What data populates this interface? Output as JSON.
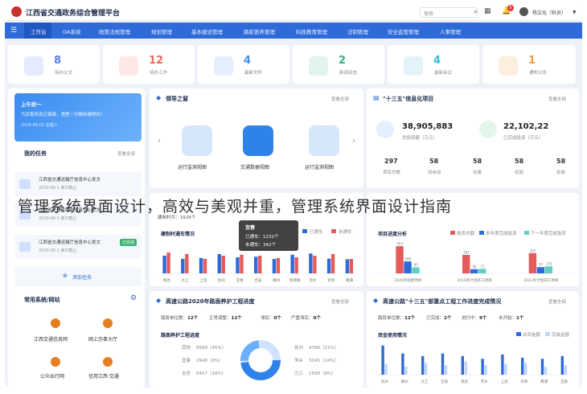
{
  "header": {
    "title": "江西省交通政务综合管理平台",
    "search_placeholder": "搜索",
    "notification_count": "5",
    "user_name": "杨文化（科员）"
  },
  "nav": {
    "items": [
      "工作台",
      "OA系统",
      "政策法规管理",
      "规划管理",
      "基本建设管理",
      "路航管养管理",
      "科技教育管理",
      "法制管理",
      "安全监管管理",
      "人事管理"
    ],
    "active_index": 0
  },
  "stats": [
    {
      "value": "8",
      "label": "待办公文",
      "icon": "document-icon",
      "color": "#5b7cf5"
    },
    {
      "value": "12",
      "label": "待办工作",
      "icon": "task-icon",
      "color": "#ee6a5a"
    },
    {
      "value": "4",
      "label": "最新文件",
      "icon": "folder-icon",
      "color": "#3f8ee8"
    },
    {
      "value": "2",
      "label": "新闻动态",
      "icon": "star-icon",
      "color": "#36b37e"
    },
    {
      "value": "4",
      "label": "最新会议",
      "icon": "microphone-icon",
      "color": "#3ab8d8"
    },
    {
      "value": "1",
      "label": "通知公告",
      "icon": "megaphone-icon",
      "color": "#f39a3c"
    }
  ],
  "greeting": {
    "title": "上午好～",
    "text": "为民服务真正健康，遇把一切都新做明白！",
    "date": "2019-06-01 星期六"
  },
  "tasks": {
    "title": "我的任务",
    "more": "查看全部",
    "items": [
      {
        "title": "江西省交通运输厅信息中心发文",
        "date": "2019-06-1 某日截止",
        "tag": ""
      },
      {
        "title": "江西省交通运输厅信息中心发文",
        "date": "2019-06-1 某日截止",
        "tag": ""
      },
      {
        "title": "江西省交通运输厅信息中心发文",
        "date": "2019-06-1 某日截止",
        "tag": "已完成"
      }
    ],
    "add": "添加任务"
  },
  "shortcuts": {
    "title": "常用系统/网站",
    "items": [
      "江西交通信息网",
      "网上办事大厅",
      "公众出行网",
      "信用江西·交通"
    ]
  },
  "leaders": {
    "title": "领导之窗",
    "more": "查看全部",
    "items": [
      "运行监测视图",
      "交通数据视图",
      "运行监测视图"
    ]
  },
  "info13": {
    "title": "\"十三五\"信息化项目",
    "more": "查看全部",
    "total_invest": "38,905,883",
    "total_invest_label": "总投资额（万元）",
    "finished_invest": "22,102,22",
    "finished_invest_label": "已完成投资（万元）",
    "counts": [
      {
        "value": "297",
        "label": "项目总数"
      },
      {
        "value": "58",
        "label": "待启动"
      },
      {
        "value": "58",
        "label": "在建"
      },
      {
        "value": "58",
        "label": "初验"
      },
      {
        "value": "58",
        "label": "验收"
      }
    ]
  },
  "watermark": "管理系统界面设计，高效与美观并重，管理系统界面设计指南",
  "villages": {
    "title": "建制村通车情况",
    "summary_prefix": "建制村共：",
    "summary_value": "1929个",
    "legend": [
      "已通车",
      "未通车"
    ],
    "tooltip": {
      "city": "宜春",
      "reached": "已通车：1232个",
      "unreached": "未通车：342个"
    },
    "chart_data": {
      "type": "bar",
      "categories": [
        "南昌",
        "九江",
        "上饶",
        "抚州",
        "宜春",
        "吉安",
        "赣州",
        "景德镇",
        "萍乡",
        "新余",
        "鹰潭"
      ],
      "series": [
        {
          "name": "已通车",
          "values": [
            55,
            45,
            48,
            60,
            50,
            52,
            45,
            58,
            62,
            46,
            44
          ]
        },
        {
          "name": "未通车",
          "values": [
            65,
            60,
            45,
            55,
            58,
            55,
            48,
            50,
            55,
            60,
            45
          ]
        }
      ],
      "ylim": [
        0,
        100
      ]
    }
  },
  "progress": {
    "title": "项目进度分析",
    "legend": [
      "投资总额",
      "本年度完成投资",
      "下一年度完成投资"
    ],
    "chart_data": {
      "type": "bar",
      "categories": [
        "2020年续建项目",
        "2019年计划开工项目",
        "2021年计划开工项目"
      ],
      "series": [
        {
          "name": "投资总额",
          "values": [
            423,
            287,
            315
          ]
        },
        {
          "name": "本年度完成投资",
          "values": [
            186,
            66,
            97
          ]
        },
        {
          "name": "下一年度完成投资",
          "values": [
            95,
            71,
            110
          ]
        }
      ],
      "ylim": [
        0,
        500
      ]
    }
  },
  "highway2020": {
    "title": "高速公路2020年路面养护工程进度",
    "more": "查看全部",
    "stats": [
      {
        "label": "路段单位数：",
        "value": "12个"
      },
      {
        "label": "正常调整：",
        "value": "12个"
      },
      {
        "label": "滞后：",
        "value": "0个"
      },
      {
        "label": "严重滞后：",
        "value": "0个"
      }
    ],
    "sub_title": "路面养护工程进度",
    "left_rows": [
      {
        "name": "其他",
        "value": "8999（45%）"
      },
      {
        "name": "宜春",
        "value": "2948（9%）"
      },
      {
        "name": "吉安",
        "value": "6457（16%）"
      }
    ],
    "right_rows": [
      {
        "name": "抚州",
        "value": "4786（23%）"
      },
      {
        "name": "萍乡",
        "value": "3245（24%）"
      },
      {
        "name": "九江",
        "value": "1598（8%）"
      }
    ]
  },
  "highway13": {
    "title": "高速公路\"十三五\"部重点工程工作进度完成情况",
    "more": "查看全部",
    "stats": [
      {
        "label": "路段单位数：",
        "value": "12个"
      },
      {
        "label": "已完成：",
        "value": "2个"
      },
      {
        "label": "进行中：",
        "value": "9个"
      },
      {
        "label": "未开始：",
        "value": "1个"
      }
    ],
    "sub_title": "资金使用情况",
    "legend": [
      "合同金额",
      "完成金额"
    ],
    "chart_data": {
      "type": "bar",
      "categories": [
        "抚州",
        "赣州",
        "九江",
        "吉安",
        "南昌",
        "萍乡",
        "上饶",
        "新余",
        "鹰潭",
        "宜春"
      ],
      "series": [
        {
          "name": "合同金额",
          "values": [
            55,
            40,
            35,
            40,
            35,
            30,
            38,
            32,
            30,
            35
          ]
        },
        {
          "name": "完成金额",
          "values": [
            20,
            15,
            22,
            18,
            25,
            18,
            20,
            22,
            15,
            18
          ]
        }
      ]
    }
  }
}
